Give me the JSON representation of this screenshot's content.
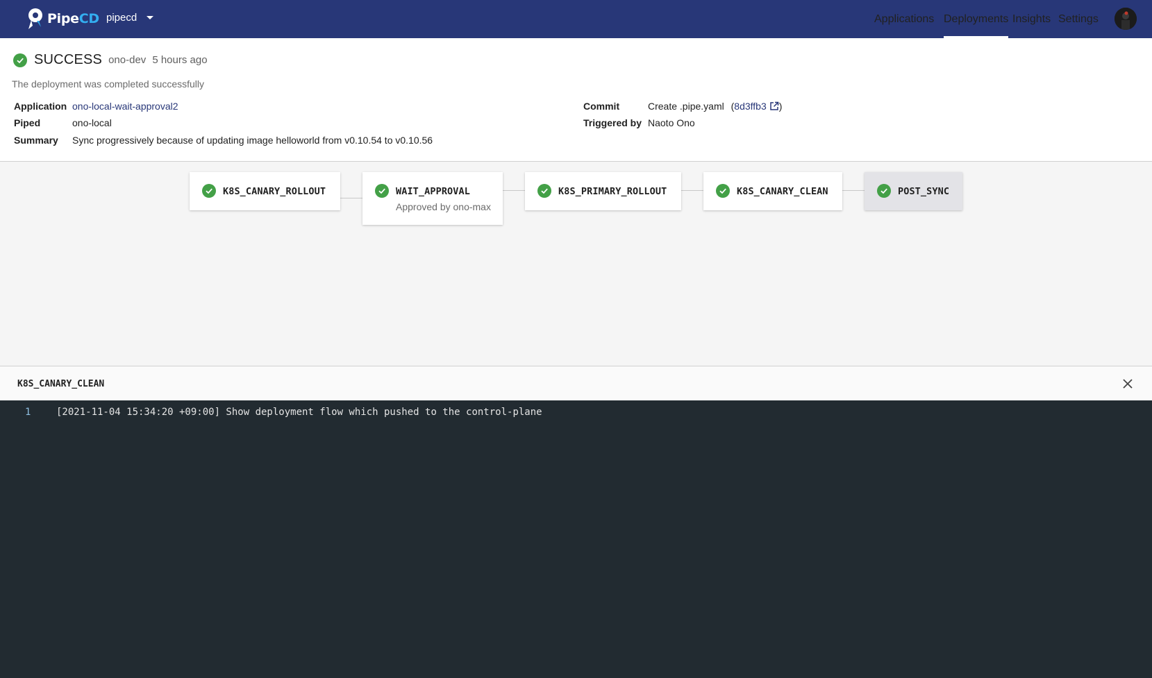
{
  "header": {
    "logo_main": "Pipe",
    "logo_accent": "CD",
    "project": "pipecd",
    "nav": [
      {
        "label": "Applications"
      },
      {
        "label": "Deployments"
      },
      {
        "label": "Insights"
      },
      {
        "label": "Settings"
      }
    ],
    "active_nav": "Deployments",
    "colors": {
      "appbar": "#283778",
      "accent": "#33aef0"
    }
  },
  "deployment": {
    "status": "SUCCESS",
    "env": "ono-dev",
    "time_ago": "5 hours ago",
    "description": "The deployment was completed successfully",
    "fields": {
      "application_label": "Application",
      "application_value": "ono-local-wait-approval2",
      "piped_label": "Piped",
      "piped_value": "ono-local",
      "summary_label": "Summary",
      "summary_value": "Sync progressively because of updating image helloworld from v0.10.54 to v0.10.56",
      "commit_label": "Commit",
      "commit_message": "Create .pipe.yaml",
      "commit_open": "(",
      "commit_hash": "8d3ffb3",
      "commit_close": ")",
      "triggered_label": "Triggered by",
      "triggered_value": "Naoto Ono"
    },
    "status_color": "#43a047"
  },
  "pipeline": {
    "stages": [
      {
        "name": "K8S_CANARY_ROLLOUT",
        "sub": ""
      },
      {
        "name": "WAIT_APPROVAL",
        "sub": "Approved by ono-max"
      },
      {
        "name": "K8S_PRIMARY_ROLLOUT",
        "sub": ""
      },
      {
        "name": "K8S_CANARY_CLEAN",
        "sub": ""
      },
      {
        "name": "POST_SYNC",
        "sub": ""
      }
    ],
    "selected_stage": "POST_SYNC"
  },
  "log": {
    "title": "K8S_CANARY_CLEAN",
    "lines": [
      {
        "no": "1",
        "text": "[2021-11-04 15:34:20 +09:00] Show deployment flow which pushed to the control-plane"
      }
    ],
    "bg_color": "#222b31"
  }
}
